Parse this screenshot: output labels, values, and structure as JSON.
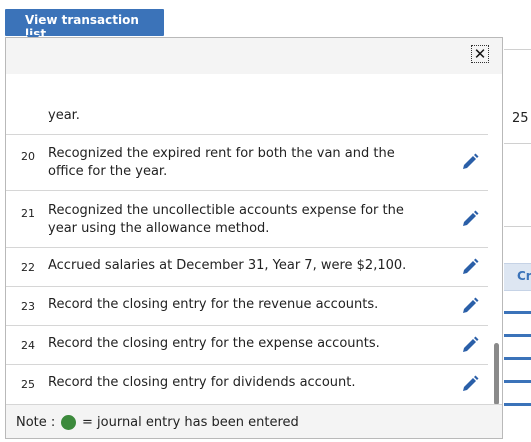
{
  "header": {
    "view_button_label": "View transaction list"
  },
  "background": {
    "right_value": "25",
    "right_header": "Cr"
  },
  "transactions": [
    {
      "num": "",
      "desc": "year."
    },
    {
      "num": "20",
      "desc": "Recognized the expired rent for both the van and the office for the year."
    },
    {
      "num": "21",
      "desc": "Recognized the uncollectible accounts expense for the year using the allowance method."
    },
    {
      "num": "22",
      "desc": "Accrued salaries at December 31, Year 7, were $2,100."
    },
    {
      "num": "23",
      "desc": "Record the closing entry for the revenue accounts."
    },
    {
      "num": "24",
      "desc": "Record the closing entry for the expense accounts."
    },
    {
      "num": "25",
      "desc": "Record the closing entry for dividends account."
    }
  ],
  "note": {
    "label": "Note :",
    "text": "= journal entry has been entered",
    "dot_color": "#3c8a3c"
  },
  "colors": {
    "accent": "#3b73b9",
    "icon": "#2a5fa8"
  },
  "icons": {
    "close": "close-icon",
    "edit": "pencil-icon"
  }
}
